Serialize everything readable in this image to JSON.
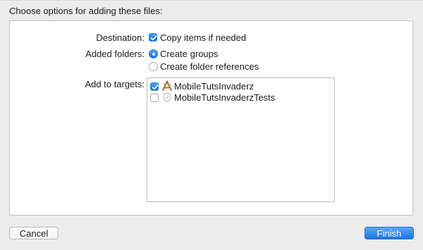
{
  "sheet": {
    "title": "Choose options for adding these files:"
  },
  "destination": {
    "label": "Destination:",
    "option_label": "Copy items if needed",
    "checked": true
  },
  "added_folders": {
    "label": "Added folders:",
    "options": [
      {
        "label": "Create groups",
        "selected": true
      },
      {
        "label": "Create folder references",
        "selected": false
      }
    ]
  },
  "targets": {
    "label": "Add to targets:",
    "items": [
      {
        "name": "MobileTutsInvaderz",
        "checked": true,
        "icon": "app-target-icon"
      },
      {
        "name": "MobileTutsInvaderzTests",
        "checked": false,
        "icon": "test-target-icon"
      }
    ]
  },
  "buttons": {
    "cancel": "Cancel",
    "finish": "Finish"
  },
  "colors": {
    "accent": "#1b73e8",
    "background": "#ececec",
    "panel": "#ffffff"
  }
}
